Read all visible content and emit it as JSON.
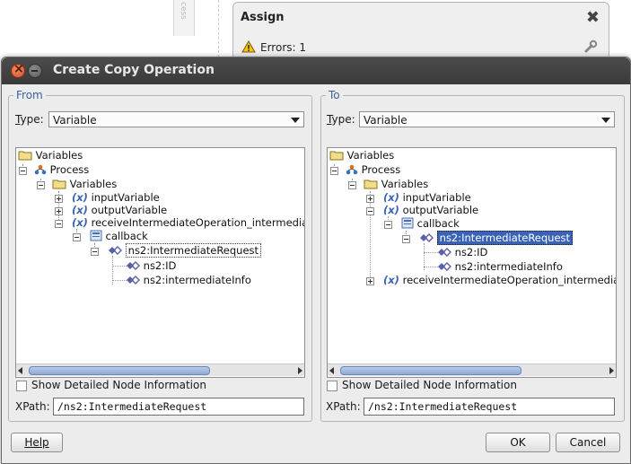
{
  "background": {
    "side_strip_text": "cess",
    "assign_card": {
      "title": "Assign",
      "errors_text": "Errors: 1"
    }
  },
  "dialog": {
    "title": "Create Copy Operation",
    "from": {
      "group_label": "From",
      "type_label": "Type:",
      "type_value": "Variable",
      "tree": [
        {
          "label": "Variables",
          "icon": "folder-icon"
        },
        {
          "label": "Process",
          "icon": "process-icon"
        },
        {
          "label": "Variables",
          "icon": "folder-icon"
        },
        {
          "label": "inputVariable",
          "icon": "variable-icon"
        },
        {
          "label": "outputVariable",
          "icon": "variable-icon"
        },
        {
          "label": "receiveIntermediateOperation_intermedia",
          "icon": "variable-icon"
        },
        {
          "label": "callback",
          "icon": "message-part-icon"
        },
        {
          "label": "ns2:IntermediateRequest",
          "icon": "element-icon"
        },
        {
          "label": "ns2:ID",
          "icon": "element-icon"
        },
        {
          "label": "ns2:intermediateInfo",
          "icon": "element-icon"
        }
      ],
      "show_detail_label": "Show Detailed Node Information",
      "show_detail_checked": false,
      "xpath_label": "XPath:",
      "xpath_value": "/ns2:IntermediateRequest"
    },
    "to": {
      "group_label": "To",
      "type_label": "Type:",
      "type_value": "Variable",
      "tree": [
        {
          "label": "Variables",
          "icon": "folder-icon"
        },
        {
          "label": "Process",
          "icon": "process-icon"
        },
        {
          "label": "Variables",
          "icon": "folder-icon"
        },
        {
          "label": "inputVariable",
          "icon": "variable-icon"
        },
        {
          "label": "outputVariable",
          "icon": "variable-icon"
        },
        {
          "label": "callback",
          "icon": "message-part-icon"
        },
        {
          "label": "ns2:IntermediateRequest",
          "icon": "element-icon"
        },
        {
          "label": "ns2:ID",
          "icon": "element-icon"
        },
        {
          "label": "ns2:intermediateInfo",
          "icon": "element-icon"
        },
        {
          "label": "receiveIntermediateOperation_intermedia",
          "icon": "variable-icon"
        }
      ],
      "show_detail_label": "Show Detailed Node Information",
      "show_detail_checked": false,
      "xpath_label": "XPath:",
      "xpath_value": "/ns2:IntermediateRequest"
    },
    "buttons": {
      "help": "Help",
      "ok": "OK",
      "cancel": "Cancel"
    },
    "colors": {
      "group_label": "#3a5fa0",
      "selection": "#3a63b8",
      "titlebar": "#3a3a3a"
    }
  }
}
